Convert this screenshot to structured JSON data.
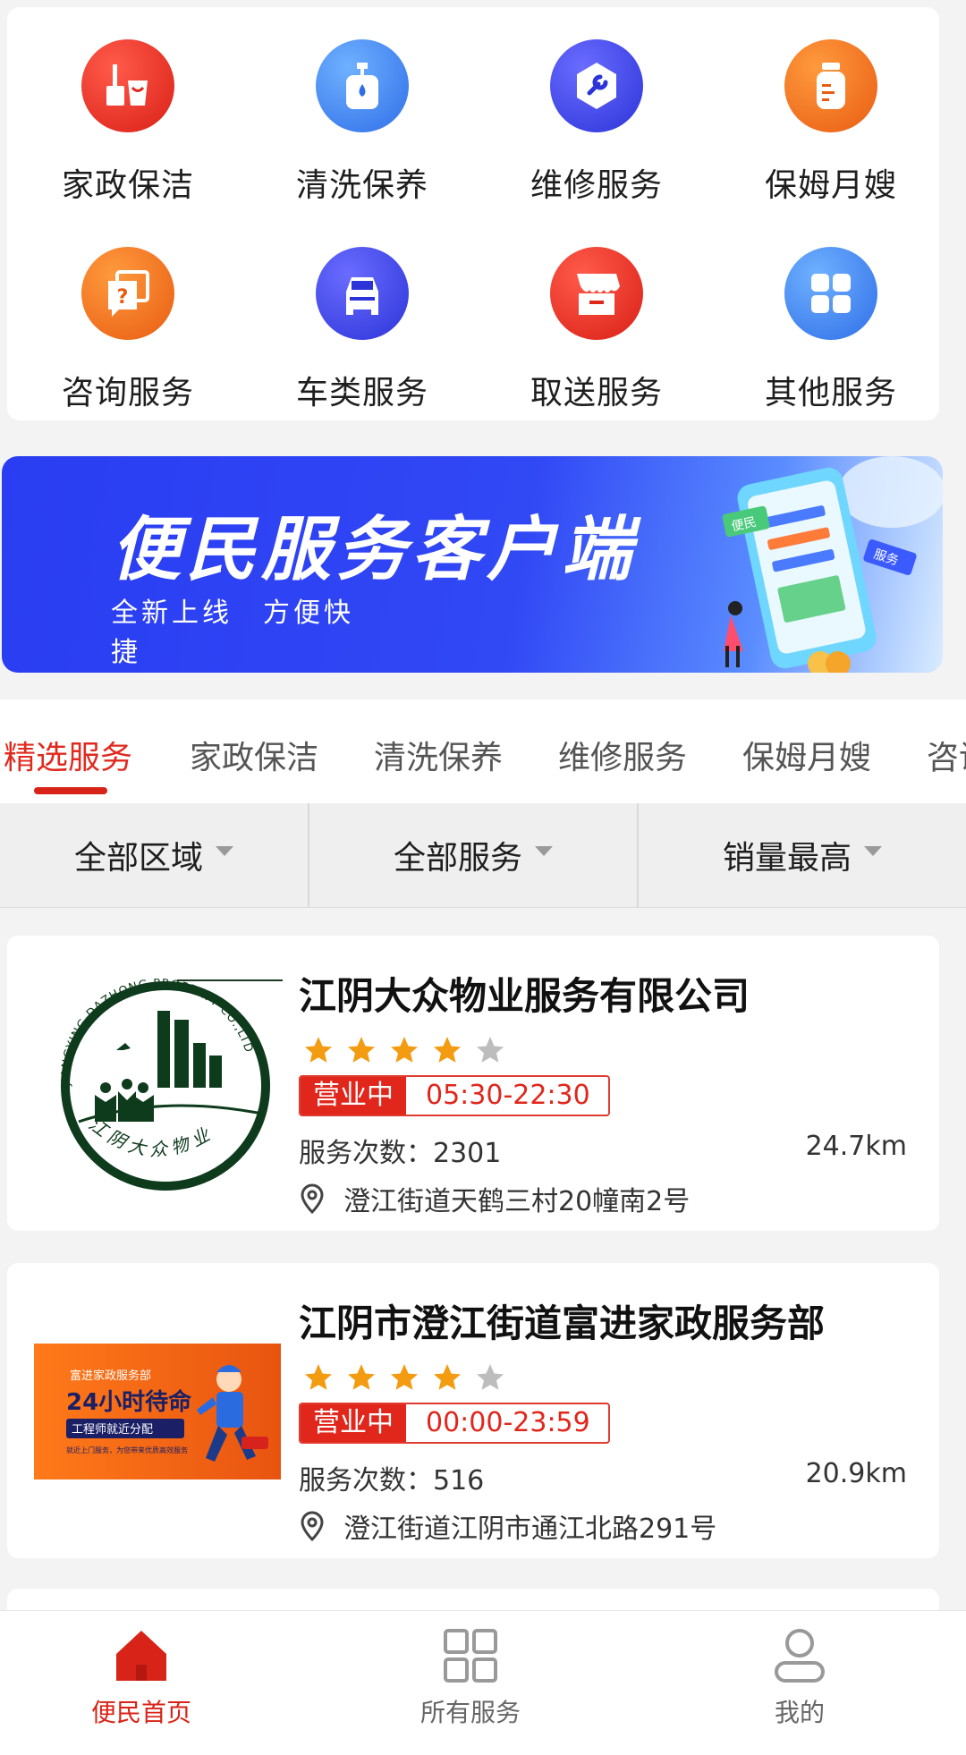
{
  "categories": [
    {
      "label": "家政保洁",
      "icon": "cleaning-icon",
      "color": "#e0271c"
    },
    {
      "label": "清洗保养",
      "icon": "soap-bottle-icon",
      "color": "#2f6ee8"
    },
    {
      "label": "维修服务",
      "icon": "wrench-icon",
      "color": "#2c34d8"
    },
    {
      "label": "保姆月嫂",
      "icon": "baby-bottle-icon",
      "color": "#e85c12"
    },
    {
      "label": "咨询服务",
      "icon": "consult-icon",
      "color": "#e85c12"
    },
    {
      "label": "车类服务",
      "icon": "car-icon",
      "color": "#2c34d8"
    },
    {
      "label": "取送服务",
      "icon": "store-icon",
      "color": "#e0271c"
    },
    {
      "label": "其他服务",
      "icon": "grid-icon",
      "color": "#2f6ee8"
    }
  ],
  "banner": {
    "title": "便民服务客户端",
    "subtitle": "全新上线　方便快捷",
    "art_labels": [
      "便民",
      "服务"
    ]
  },
  "tabs": [
    "精选服务",
    "家政保洁",
    "清洗保养",
    "维修服务",
    "保姆月嫂",
    "咨询"
  ],
  "active_tab": 0,
  "filters": {
    "region": "全部区域",
    "service": "全部服务",
    "sort": "销量最高"
  },
  "shops": [
    {
      "name": "江阴大众物业服务有限公司",
      "rating": 4,
      "status": "营业中",
      "hours": "05:30-22:30",
      "count_label": "服务次数：2301",
      "distance": "24.7km",
      "address": "澄江街道天鹤三村20幢南2号",
      "logo_text_top": "JIANGYING DAZHONG PROPERTY CO.,LTD",
      "logo_text_bottom": "江阴大众物业"
    },
    {
      "name": "江阴市澄江街道富进家政服务部",
      "rating": 4,
      "status": "营业中",
      "hours": "00:00-23:59",
      "count_label": "服务次数：516",
      "distance": "20.9km",
      "address": "澄江街道江阴市通江北路291号",
      "logo_line1": "富进家政服务部",
      "logo_line2": "24小时待命",
      "logo_line3": "工程师就近分配",
      "logo_line4": "就近上门服务，为您带来优质高效服务"
    }
  ],
  "bottom_nav": [
    {
      "label": "便民首页",
      "icon": "home-icon",
      "active": true
    },
    {
      "label": "所有服务",
      "icon": "grid-icon",
      "active": false
    },
    {
      "label": "我的",
      "icon": "user-icon",
      "active": false
    }
  ],
  "colors": {
    "accent": "#e02a1f",
    "star": "#f39c12",
    "star_off": "#bdbdbd",
    "banner_blue": "#2a3df2"
  }
}
